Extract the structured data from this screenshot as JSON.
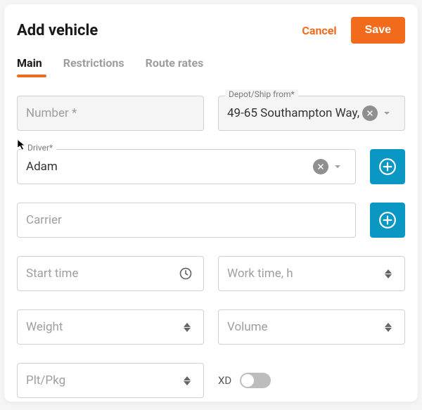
{
  "header": {
    "title": "Add vehicle",
    "cancel_label": "Cancel",
    "save_label": "Save"
  },
  "tabs": {
    "main": "Main",
    "restrictions": "Restrictions",
    "route_rates": "Route rates"
  },
  "fields": {
    "number": {
      "placeholder": "Number *"
    },
    "depot": {
      "label": "Depot/Ship from*",
      "value": "49-65 Southampton Way,"
    },
    "driver": {
      "label": "Driver*",
      "value": "Adam"
    },
    "carrier": {
      "placeholder": "Carrier"
    },
    "start_time": {
      "placeholder": "Start time"
    },
    "work_time": {
      "placeholder": "Work time, h"
    },
    "weight": {
      "placeholder": "Weight"
    },
    "volume": {
      "placeholder": "Volume"
    },
    "plt_pkg": {
      "placeholder": "Plt/Pkg"
    },
    "xd": {
      "label": "XD",
      "value": false
    }
  }
}
